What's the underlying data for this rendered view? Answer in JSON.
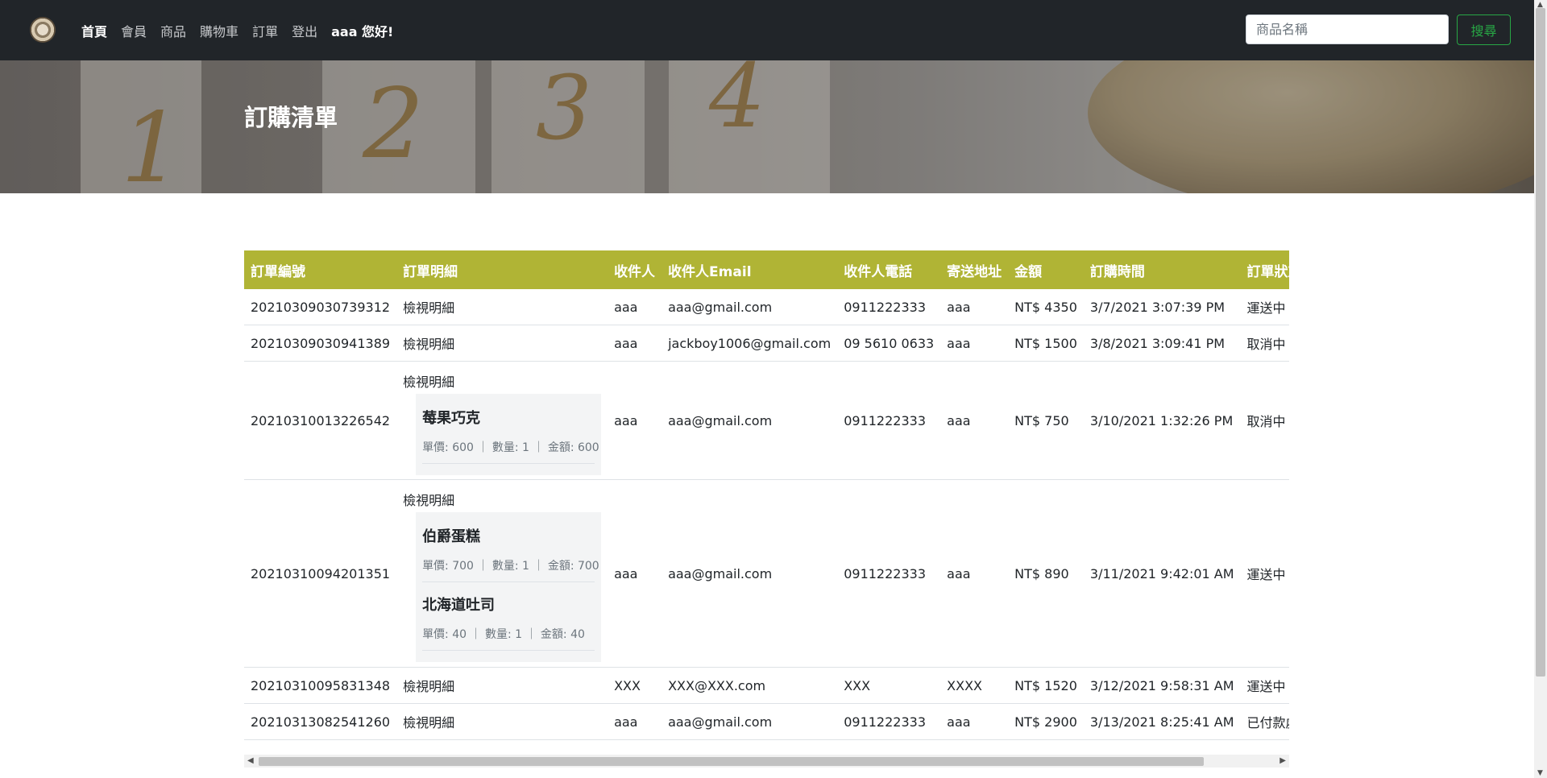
{
  "nav": {
    "links": [
      "首頁",
      "會員",
      "商品",
      "購物車",
      "訂單",
      "登出"
    ],
    "user": "aaa 您好!",
    "search_placeholder": "商品名稱",
    "search_button": "搜尋"
  },
  "hero": {
    "title": "訂購清單",
    "numbers": [
      "1",
      "2",
      "3",
      "4"
    ]
  },
  "table": {
    "headers": [
      "訂單編號",
      "訂單明細",
      "收件人",
      "收件人Email",
      "收件人電話",
      "寄送地址",
      "金額",
      "訂購時間",
      "訂單狀態"
    ],
    "rows": [
      {
        "id": "20210309030739312",
        "detail_link": "檢視明細",
        "name": "aaa",
        "email": "aaa@gmail.com",
        "phone": "0911222333",
        "address": "aaa",
        "amount": "NT$ 4350",
        "time": "3/7/2021 3:07:39 PM",
        "status": "運送中"
      },
      {
        "id": "20210309030941389",
        "detail_link": "檢視明細",
        "name": "aaa",
        "email": "jackboy1006@gmail.com",
        "phone": "09 5610 0633",
        "address": "aaa",
        "amount": "NT$ 1500",
        "time": "3/8/2021 3:09:41 PM",
        "status": "取消中"
      },
      {
        "id": "20210310013226542",
        "detail_link": "檢視明細",
        "name": "aaa",
        "email": "aaa@gmail.com",
        "phone": "0911222333",
        "address": "aaa",
        "amount": "NT$ 750",
        "time": "3/10/2021 1:32:26 PM",
        "status": "取消中",
        "items": [
          {
            "name": "莓果巧克",
            "meta": "單價: 600 ｜ 數量: 1 ｜ 金額: 600"
          }
        ]
      },
      {
        "id": "20210310094201351",
        "detail_link": "檢視明細",
        "name": "aaa",
        "email": "aaa@gmail.com",
        "phone": "0911222333",
        "address": "aaa",
        "amount": "NT$ 890",
        "time": "3/11/2021 9:42:01 AM",
        "status": "運送中",
        "items": [
          {
            "name": "伯爵蛋糕",
            "meta": "單價: 700 ｜ 數量: 1 ｜ 金額: 700"
          },
          {
            "name": "北海道吐司",
            "meta": "單價: 40 ｜ 數量: 1 ｜ 金額: 40"
          }
        ]
      },
      {
        "id": "20210310095831348",
        "detail_link": "檢視明細",
        "name": "XXX",
        "email": "XXX@XXX.com",
        "phone": "XXX",
        "address": "XXXX",
        "amount": "NT$ 1520",
        "time": "3/12/2021 9:58:31 AM",
        "status": "運送中"
      },
      {
        "id": "20210313082541260",
        "detail_link": "檢視明細",
        "name": "aaa",
        "email": "aaa@gmail.com",
        "phone": "0911222333",
        "address": "aaa",
        "amount": "NT$ 2900",
        "time": "3/13/2021 8:25:41 AM",
        "status": "已付款處理中"
      }
    ]
  },
  "colors": {
    "header_bg": "#b0b435",
    "navbar_bg": "#212529",
    "search_button": "#28a745"
  }
}
